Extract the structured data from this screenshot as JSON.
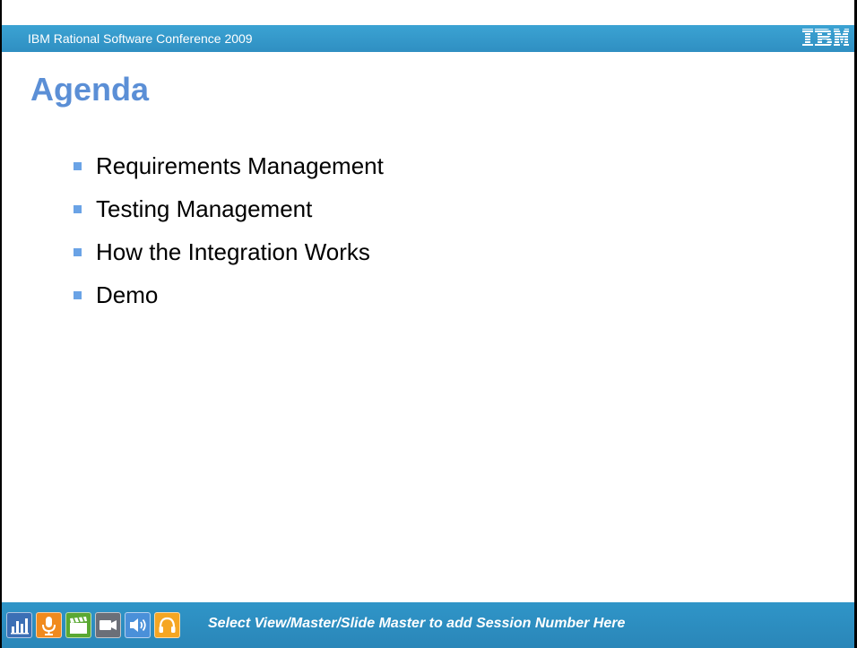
{
  "header": {
    "conference_title": "IBM Rational Software Conference 2009",
    "logo_text": "IBM"
  },
  "slide": {
    "title": "Agenda",
    "bullets": [
      "Requirements Management",
      "Testing Management",
      "How the Integration Works",
      "Demo"
    ]
  },
  "footer": {
    "session_text": "Select View/Master/Slide Master to add Session Number Here",
    "icons": [
      {
        "name": "chart-icon",
        "color": "#3b6fb5"
      },
      {
        "name": "microphone-icon",
        "color": "#f08a1e"
      },
      {
        "name": "clapperboard-icon",
        "color": "#5aa832"
      },
      {
        "name": "camera-icon",
        "color": "#6b6f78"
      },
      {
        "name": "speaker-icon",
        "color": "#4a90d9"
      },
      {
        "name": "headphones-icon",
        "color": "#f5a623"
      }
    ]
  },
  "colors": {
    "header_bar": "#3399cc",
    "title": "#5b8fd6",
    "bullet_marker": "#6aa3e6",
    "footer_bar": "#2a8abd"
  }
}
